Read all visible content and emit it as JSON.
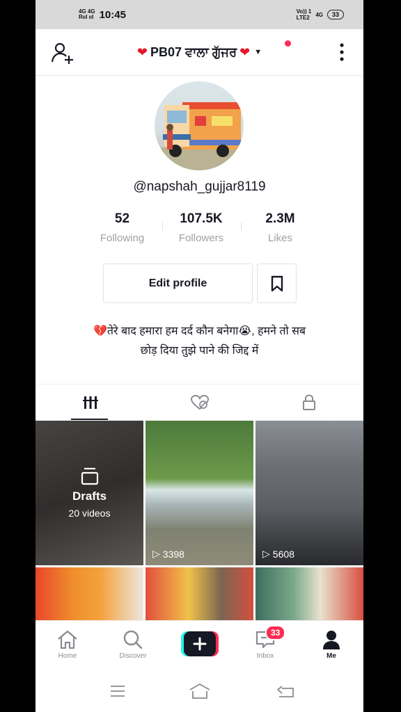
{
  "status_bar": {
    "net_top": "4G 4G",
    "net_bottom": "Rııl ııl",
    "time": "10:45",
    "volte_top": "Vo)) 1",
    "volte_bottom": "LTE2",
    "net2": "4G",
    "battery": "33"
  },
  "header": {
    "title_text": "PB07 ਵਾਲਾ ਗੁੱਜਰ",
    "heart": "❤"
  },
  "profile": {
    "username": "@napshah_gujjar8119",
    "stats": [
      {
        "value": "52",
        "label": "Following"
      },
      {
        "value": "107.5K",
        "label": "Followers"
      },
      {
        "value": "2.3M",
        "label": "Likes"
      }
    ],
    "edit_label": "Edit profile",
    "bio_line1": "💔तेरे बाद हमारा हम दर्द कौन बनेगा😭, हमने तो सब",
    "bio_line2": "छोड़ दिया तुझे पाने की जिद्द में"
  },
  "grid": {
    "drafts_title": "Drafts",
    "drafts_count": "20 videos",
    "views": [
      "3398",
      "5608"
    ]
  },
  "bottom_nav": {
    "home": "Home",
    "discover": "Discover",
    "inbox": "Inbox",
    "inbox_badge": "33",
    "me": "Me"
  }
}
